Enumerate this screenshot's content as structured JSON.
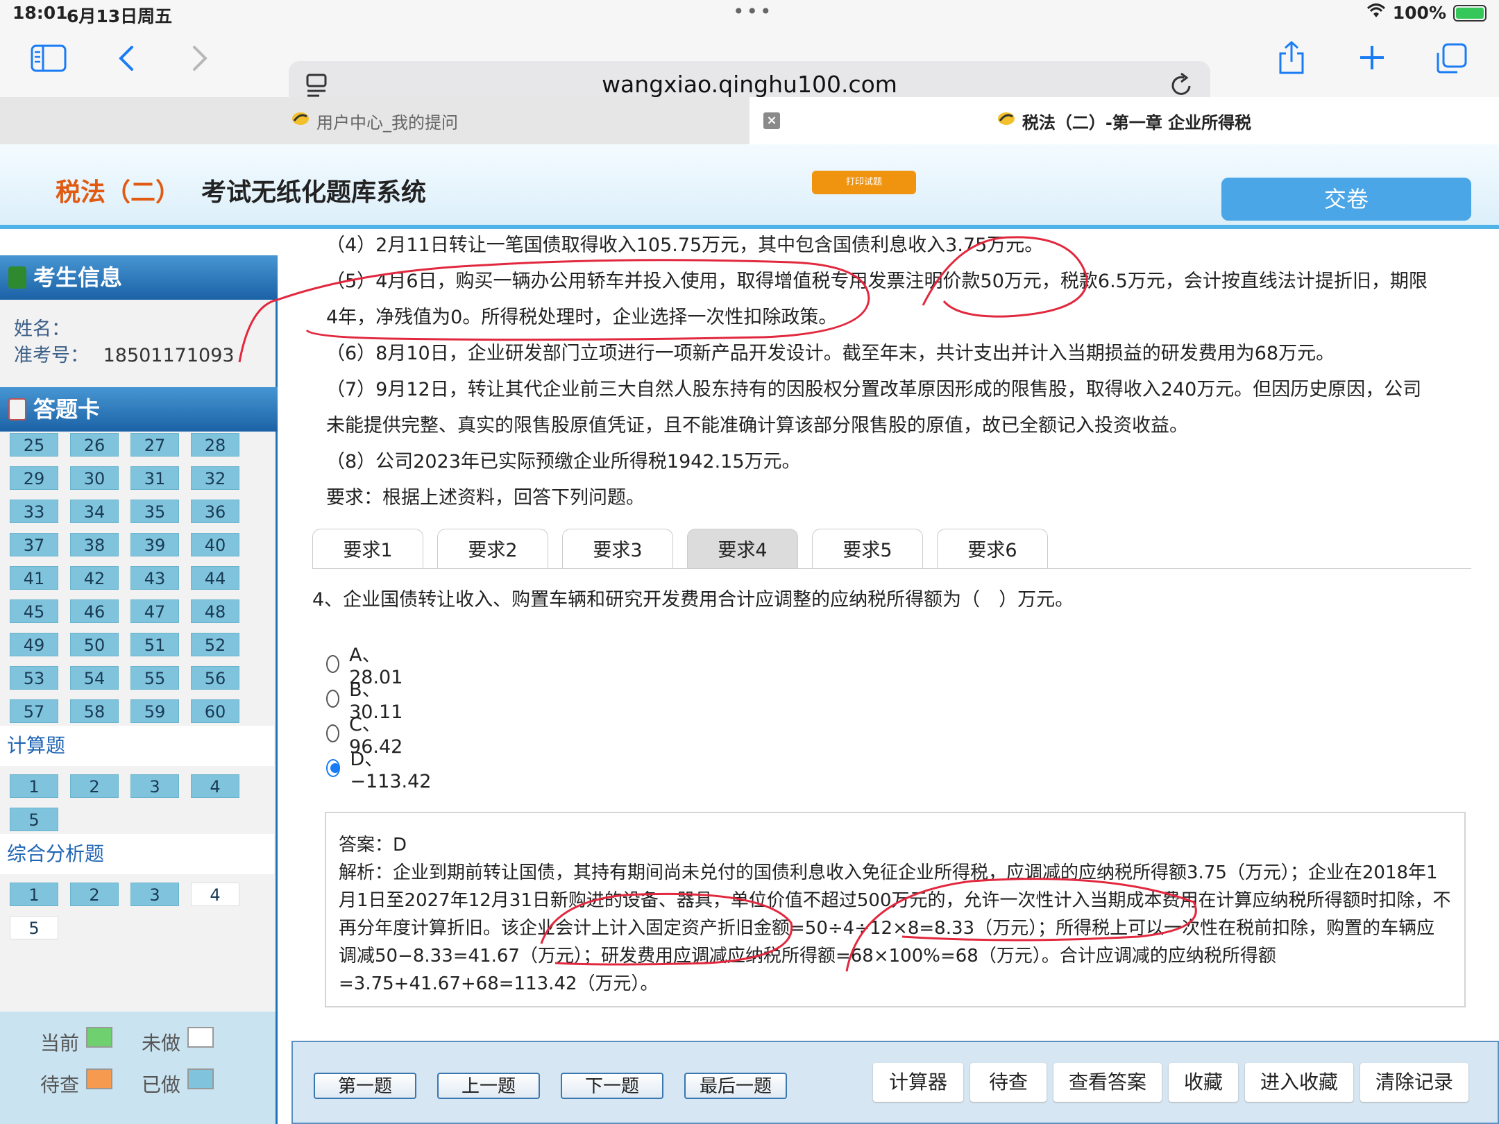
{
  "status_bar": {
    "time": "18:01",
    "date": "6月13日周五",
    "battery": "100%"
  },
  "browser": {
    "url": "wangxiao.qinghu100.com",
    "tabs": [
      {
        "label": "用户中心_我的提问"
      },
      {
        "label": "税法（二）-第一章 企业所得税"
      }
    ]
  },
  "header": {
    "subject": "税法（二）",
    "system_name": "考试无纸化题库系统",
    "print_label": "打印试题",
    "submit_label": "交卷"
  },
  "sidebar": {
    "candidate_title": "考生信息",
    "name_label": "姓名：",
    "name_value": "",
    "id_label": "准考号：",
    "id_value": "18501171093",
    "card_title": "答题卡",
    "grid_numbers": [
      "25",
      "26",
      "27",
      "28",
      "29",
      "30",
      "31",
      "32",
      "33",
      "34",
      "35",
      "36",
      "37",
      "38",
      "39",
      "40",
      "41",
      "42",
      "43",
      "44",
      "45",
      "46",
      "47",
      "48",
      "49",
      "50",
      "51",
      "52",
      "53",
      "54",
      "55",
      "56",
      "57",
      "58",
      "59",
      "60"
    ],
    "section_calc": "计算题",
    "calc_numbers": [
      "1",
      "2",
      "3",
      "4",
      "5"
    ],
    "section_comp": "综合分析题",
    "comp_numbers": [
      "1",
      "2",
      "3",
      "4",
      "5"
    ],
    "legend": {
      "current": "当前",
      "undone": "未做",
      "pending": "待查",
      "done": "已做"
    },
    "legend_colors": {
      "current": "#6fd06f",
      "undone": "#ffffff",
      "pending": "#f59a4f",
      "done": "#7fc4dc"
    }
  },
  "main": {
    "paragraphs": [
      "（4）2月11日转让一笔国债取得收入105.75万元，其中包含国债利息收入3.75万元。",
      "（5）4月6日，购买一辆办公用轿车并投入使用，取得增值税专用发票注明价款50万元，税款6.5万元，会计按直线法计提折旧，期限",
      "4年，净残值为0。所得税处理时，企业选择一次性扣除政策。",
      "（6）8月10日，企业研发部门立项进行一项新产品开发设计。截至年末，共计支出并计入当期损益的研发费用为68万元。",
      "（7）9月12日，转让其代企业前三大自然人股东持有的因股权分置改革原因形成的限售股，取得收入240万元。但因历史原因，公司",
      "未能提供完整、真实的限售股原值凭证，且不能准确计算该部分限售股的原值，故已全额记入投资收益。",
      "（8）公司2023年已实际预缴企业所得税1942.15万元。",
      "要求：根据上述资料，回答下列问题。"
    ],
    "req_tabs": [
      "要求1",
      "要求2",
      "要求3",
      "要求4",
      "要求5",
      "要求6"
    ],
    "question": "4、企业国债转让收入、购置车辆和研究开发费用合计应调整的应纳税所得额为（　）万元。",
    "options": [
      {
        "label": "A、28.01"
      },
      {
        "label": "B、30.11"
      },
      {
        "label": "C、96.42"
      },
      {
        "label": "D、−113.42"
      }
    ],
    "selected_option": "D",
    "answer_label": "答案：D",
    "analysis": "解析：企业到期前转让国债，其持有期间尚未兑付的国债利息收入免征企业所得税，应调减的应纳税所得额3.75（万元）；企业在2018年1月1日至2027年12月31日新购进的设备、器具，单位价值不超过500万元的，允许一次性计入当期成本费用在计算应纳税所得额时扣除，不再分年度计算折旧。该企业会计上计入固定资产折旧金额=50÷4÷12×8=8.33（万元）；所得税上可以一次性在税前扣除，购置的车辆应调减50−8.33=41.67（万元）；研发费用应调减应纳税所得额=68×100%=68（万元）。合计应调减的应纳税所得额=3.75+41.67+68=113.42（万元）。"
  },
  "bottom": {
    "nav": [
      "第一题",
      "上一题",
      "下一题",
      "最后一题"
    ],
    "funcs": [
      "计算器",
      "待查",
      "查看答案",
      "收藏",
      "进入收藏",
      "清除记录"
    ]
  }
}
